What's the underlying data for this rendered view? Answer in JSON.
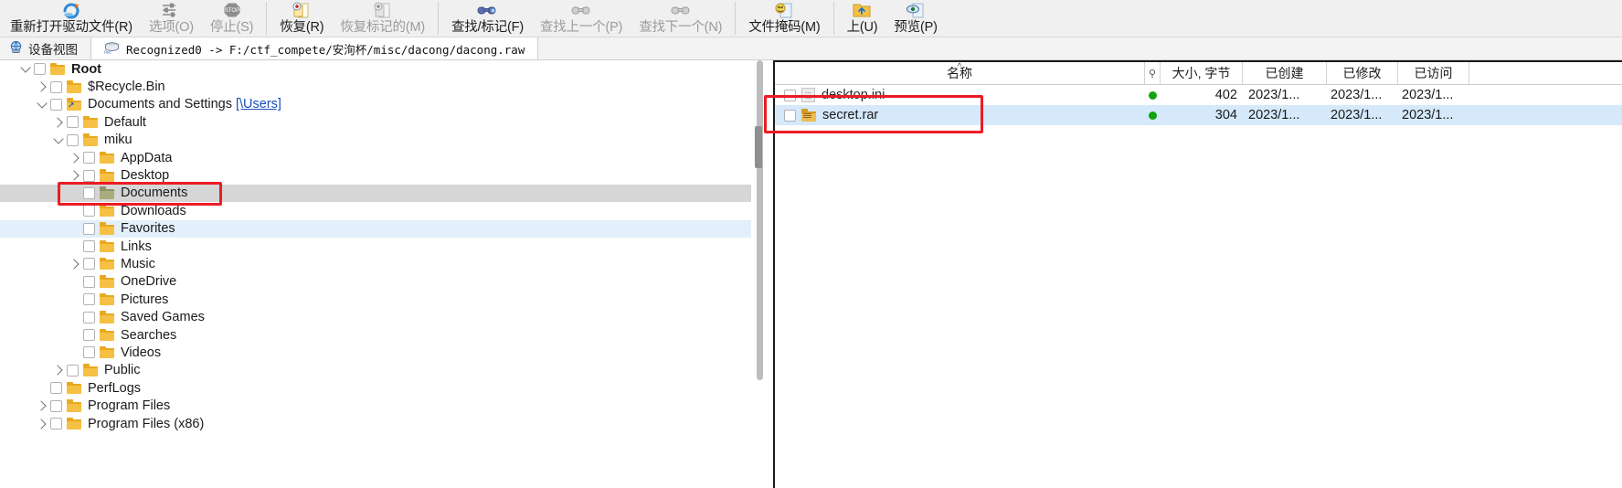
{
  "toolbar": {
    "items": [
      {
        "label": "重新打开驱动文件(R)",
        "icon": "reopen-drive-icon",
        "disabled": false
      },
      {
        "label": "选项(O)",
        "icon": "options-icon",
        "disabled": true
      },
      {
        "label": "停止(S)",
        "icon": "stop-icon",
        "disabled": true
      },
      {
        "label": "恢复(R)",
        "icon": "recover-icon",
        "disabled": false
      },
      {
        "label": "恢复标记的(M)",
        "icon": "recover-marked-icon",
        "disabled": true
      },
      {
        "label": "查找/标记(F)",
        "icon": "find-mark-icon",
        "disabled": false
      },
      {
        "label": "查找上一个(P)",
        "icon": "find-previous-icon",
        "disabled": true
      },
      {
        "label": "查找下一个(N)",
        "icon": "find-next-icon",
        "disabled": true
      },
      {
        "label": "文件掩码(M)",
        "icon": "file-mask-icon",
        "disabled": false
      },
      {
        "label": "上(U)",
        "icon": "up-folder-icon",
        "disabled": false
      },
      {
        "label": "预览(P)",
        "icon": "preview-icon",
        "disabled": false
      }
    ],
    "separators_after": [
      2,
      4,
      7,
      8
    ]
  },
  "addressbar": {
    "device_view_label": "设备视图",
    "device_view_icon": "device-view-icon",
    "path_icon": "recognized-drive-icon",
    "path_label": "Recognized0 -> F:/ctf_compete/安洵杯/misc/dacong/dacong.raw"
  },
  "tree": {
    "rows": [
      {
        "label": "Root",
        "indent": 0,
        "twisty": "down",
        "bold": true,
        "folder": "yellow",
        "highlight": "none"
      },
      {
        "label": "$Recycle.Bin",
        "indent": 1,
        "twisty": "right",
        "bold": false,
        "folder": "yellow",
        "highlight": "none"
      },
      {
        "label": "Documents and Settings ",
        "link": "[\\Users]",
        "indent": 1,
        "twisty": "down",
        "bold": false,
        "folder": "link",
        "highlight": "none"
      },
      {
        "label": "Default",
        "indent": 2,
        "twisty": "right",
        "bold": false,
        "folder": "yellow",
        "highlight": "none"
      },
      {
        "label": "miku",
        "indent": 2,
        "twisty": "down",
        "bold": false,
        "folder": "yellow",
        "highlight": "none"
      },
      {
        "label": "AppData",
        "indent": 3,
        "twisty": "right",
        "bold": false,
        "folder": "yellow",
        "highlight": "none"
      },
      {
        "label": "Desktop",
        "indent": 3,
        "twisty": "right",
        "bold": false,
        "folder": "yellow",
        "highlight": "none"
      },
      {
        "label": "Documents",
        "indent": 3,
        "twisty": "none",
        "bold": false,
        "folder": "olive",
        "highlight": "gray"
      },
      {
        "label": "Downloads",
        "indent": 3,
        "twisty": "none",
        "bold": false,
        "folder": "yellow",
        "highlight": "none"
      },
      {
        "label": "Favorites",
        "indent": 3,
        "twisty": "none",
        "bold": false,
        "folder": "yellow",
        "highlight": "blue"
      },
      {
        "label": "Links",
        "indent": 3,
        "twisty": "none",
        "bold": false,
        "folder": "yellow",
        "highlight": "none"
      },
      {
        "label": "Music",
        "indent": 3,
        "twisty": "right",
        "bold": false,
        "folder": "yellow",
        "highlight": "none"
      },
      {
        "label": "OneDrive",
        "indent": 3,
        "twisty": "none",
        "bold": false,
        "folder": "yellow",
        "highlight": "none"
      },
      {
        "label": "Pictures",
        "indent": 3,
        "twisty": "none",
        "bold": false,
        "folder": "yellow",
        "highlight": "none"
      },
      {
        "label": "Saved Games",
        "indent": 3,
        "twisty": "none",
        "bold": false,
        "folder": "yellow",
        "highlight": "none"
      },
      {
        "label": "Searches",
        "indent": 3,
        "twisty": "none",
        "bold": false,
        "folder": "yellow",
        "highlight": "none"
      },
      {
        "label": "Videos",
        "indent": 3,
        "twisty": "none",
        "bold": false,
        "folder": "yellow",
        "highlight": "none"
      },
      {
        "label": "Public",
        "indent": 2,
        "twisty": "right",
        "bold": false,
        "folder": "yellow",
        "highlight": "none"
      },
      {
        "label": "PerfLogs",
        "indent": 1,
        "twisty": "none",
        "bold": false,
        "folder": "yellow",
        "highlight": "none"
      },
      {
        "label": "Program Files",
        "indent": 1,
        "twisty": "right",
        "bold": false,
        "folder": "yellow",
        "highlight": "none"
      },
      {
        "label": "Program Files (x86)",
        "indent": 1,
        "twisty": "right",
        "bold": false,
        "folder": "yellow",
        "highlight": "none"
      }
    ]
  },
  "filelist": {
    "columns": {
      "name": "名称",
      "flag": "",
      "size": "大小, 字节",
      "created": "已创建",
      "modified": "已修改",
      "accessed": "已访问"
    },
    "sort_column": "名称",
    "sort_direction": "asc",
    "rows": [
      {
        "name": "desktop.ini",
        "icon": "ini-file-icon",
        "flag": "green-dot",
        "size": "402",
        "created": "2023/1...",
        "modified": "2023/1...",
        "accessed": "2023/1...",
        "selected": false
      },
      {
        "name": "secret.rar",
        "icon": "rar-archive-icon",
        "flag": "green-dot",
        "size": "304",
        "created": "2023/1...",
        "modified": "2023/1...",
        "accessed": "2023/1...",
        "selected": true
      }
    ]
  },
  "annotations": [
    {
      "id": "annot-documents",
      "target": "Documents",
      "color": "#ec1c24"
    },
    {
      "id": "annot-secret",
      "target": "secret.rar",
      "color": "#ec1c24"
    }
  ]
}
